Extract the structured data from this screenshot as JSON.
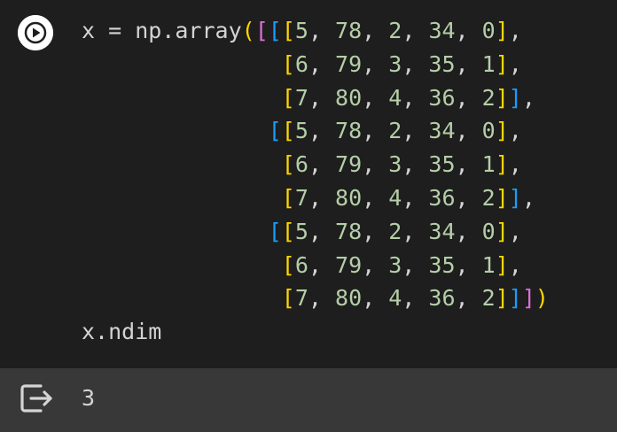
{
  "colors": {
    "default": "#d4d4d4",
    "number": "#b5cea8",
    "bracket_gold": "#ffd700",
    "bracket_magenta": "#da70d6",
    "bracket_blue": "#179fff",
    "cell_bg": "#1e1e1e",
    "output_bg": "#383838"
  },
  "run_button": {
    "icon": "play-icon"
  },
  "code_lines": [
    [
      [
        "x = np.array",
        "default"
      ],
      [
        "(",
        "bracket_gold"
      ],
      [
        "[",
        "bracket_magenta"
      ],
      [
        "[",
        "bracket_blue"
      ],
      [
        "[",
        "bracket_gold"
      ],
      [
        "5",
        "number"
      ],
      [
        ", ",
        "default"
      ],
      [
        "78",
        "number"
      ],
      [
        ", ",
        "default"
      ],
      [
        "2",
        "number"
      ],
      [
        ", ",
        "default"
      ],
      [
        "34",
        "number"
      ],
      [
        ", ",
        "default"
      ],
      [
        "0",
        "number"
      ],
      [
        "]",
        "bracket_gold"
      ],
      [
        ",",
        "default"
      ]
    ],
    [
      [
        "               ",
        "default"
      ],
      [
        "[",
        "bracket_gold"
      ],
      [
        "6",
        "number"
      ],
      [
        ", ",
        "default"
      ],
      [
        "79",
        "number"
      ],
      [
        ", ",
        "default"
      ],
      [
        "3",
        "number"
      ],
      [
        ", ",
        "default"
      ],
      [
        "35",
        "number"
      ],
      [
        ", ",
        "default"
      ],
      [
        "1",
        "number"
      ],
      [
        "]",
        "bracket_gold"
      ],
      [
        ",",
        "default"
      ]
    ],
    [
      [
        "               ",
        "default"
      ],
      [
        "[",
        "bracket_gold"
      ],
      [
        "7",
        "number"
      ],
      [
        ", ",
        "default"
      ],
      [
        "80",
        "number"
      ],
      [
        ", ",
        "default"
      ],
      [
        "4",
        "number"
      ],
      [
        ", ",
        "default"
      ],
      [
        "36",
        "number"
      ],
      [
        ", ",
        "default"
      ],
      [
        "2",
        "number"
      ],
      [
        "]",
        "bracket_gold"
      ],
      [
        "]",
        "bracket_blue"
      ],
      [
        ",",
        "default"
      ]
    ],
    [
      [
        "              ",
        "default"
      ],
      [
        "[",
        "bracket_blue"
      ],
      [
        "[",
        "bracket_gold"
      ],
      [
        "5",
        "number"
      ],
      [
        ", ",
        "default"
      ],
      [
        "78",
        "number"
      ],
      [
        ", ",
        "default"
      ],
      [
        "2",
        "number"
      ],
      [
        ", ",
        "default"
      ],
      [
        "34",
        "number"
      ],
      [
        ", ",
        "default"
      ],
      [
        "0",
        "number"
      ],
      [
        "]",
        "bracket_gold"
      ],
      [
        ",",
        "default"
      ]
    ],
    [
      [
        "               ",
        "default"
      ],
      [
        "[",
        "bracket_gold"
      ],
      [
        "6",
        "number"
      ],
      [
        ", ",
        "default"
      ],
      [
        "79",
        "number"
      ],
      [
        ", ",
        "default"
      ],
      [
        "3",
        "number"
      ],
      [
        ", ",
        "default"
      ],
      [
        "35",
        "number"
      ],
      [
        ", ",
        "default"
      ],
      [
        "1",
        "number"
      ],
      [
        "]",
        "bracket_gold"
      ],
      [
        ",",
        "default"
      ]
    ],
    [
      [
        "               ",
        "default"
      ],
      [
        "[",
        "bracket_gold"
      ],
      [
        "7",
        "number"
      ],
      [
        ", ",
        "default"
      ],
      [
        "80",
        "number"
      ],
      [
        ", ",
        "default"
      ],
      [
        "4",
        "number"
      ],
      [
        ", ",
        "default"
      ],
      [
        "36",
        "number"
      ],
      [
        ", ",
        "default"
      ],
      [
        "2",
        "number"
      ],
      [
        "]",
        "bracket_gold"
      ],
      [
        "]",
        "bracket_blue"
      ],
      [
        ",",
        "default"
      ]
    ],
    [
      [
        "              ",
        "default"
      ],
      [
        "[",
        "bracket_blue"
      ],
      [
        "[",
        "bracket_gold"
      ],
      [
        "5",
        "number"
      ],
      [
        ", ",
        "default"
      ],
      [
        "78",
        "number"
      ],
      [
        ", ",
        "default"
      ],
      [
        "2",
        "number"
      ],
      [
        ", ",
        "default"
      ],
      [
        "34",
        "number"
      ],
      [
        ", ",
        "default"
      ],
      [
        "0",
        "number"
      ],
      [
        "]",
        "bracket_gold"
      ],
      [
        ",",
        "default"
      ]
    ],
    [
      [
        "               ",
        "default"
      ],
      [
        "[",
        "bracket_gold"
      ],
      [
        "6",
        "number"
      ],
      [
        ", ",
        "default"
      ],
      [
        "79",
        "number"
      ],
      [
        ", ",
        "default"
      ],
      [
        "3",
        "number"
      ],
      [
        ", ",
        "default"
      ],
      [
        "35",
        "number"
      ],
      [
        ", ",
        "default"
      ],
      [
        "1",
        "number"
      ],
      [
        "]",
        "bracket_gold"
      ],
      [
        ",",
        "default"
      ]
    ],
    [
      [
        "               ",
        "default"
      ],
      [
        "[",
        "bracket_gold"
      ],
      [
        "7",
        "number"
      ],
      [
        ", ",
        "default"
      ],
      [
        "80",
        "number"
      ],
      [
        ", ",
        "default"
      ],
      [
        "4",
        "number"
      ],
      [
        ", ",
        "default"
      ],
      [
        "36",
        "number"
      ],
      [
        ", ",
        "default"
      ],
      [
        "2",
        "number"
      ],
      [
        "]",
        "bracket_gold"
      ],
      [
        "]",
        "bracket_blue"
      ],
      [
        "]",
        "bracket_magenta"
      ],
      [
        ")",
        "bracket_gold"
      ]
    ],
    [
      [
        "x.ndim",
        "default"
      ]
    ]
  ],
  "output": {
    "icon": "output-exit-icon",
    "text": "3"
  }
}
